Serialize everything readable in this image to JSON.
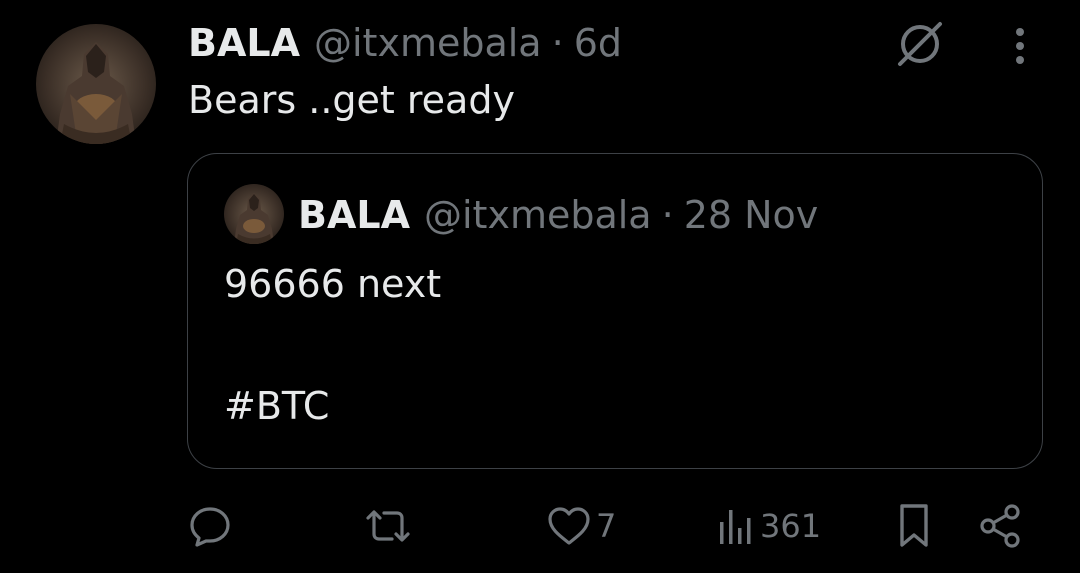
{
  "post": {
    "author_name": "BALA",
    "author_handle": "@itxmebala",
    "separator": "·",
    "time": "6d",
    "text": "Bears ..get ready",
    "avatar_icon": "hooded-figure-avatar",
    "grok_icon": "grok-icon",
    "more_icon": "more-vertical-icon"
  },
  "quoted_post": {
    "author_name": "BALA",
    "author_handle": "@itxmebala",
    "separator": "·",
    "time": "28 Nov",
    "text_line1": "96666 next",
    "text_line2": "#BTC"
  },
  "actions": {
    "reply_icon": "reply-icon",
    "repost_icon": "repost-icon",
    "like_icon": "like-icon",
    "like_count": "7",
    "views_icon": "views-icon",
    "views_count": "361",
    "bookmark_icon": "bookmark-icon",
    "share_icon": "share-icon"
  },
  "colors": {
    "background": "#000000",
    "primary_text": "#e7e9ea",
    "secondary_text": "#71767b",
    "border": "#3d4146"
  }
}
